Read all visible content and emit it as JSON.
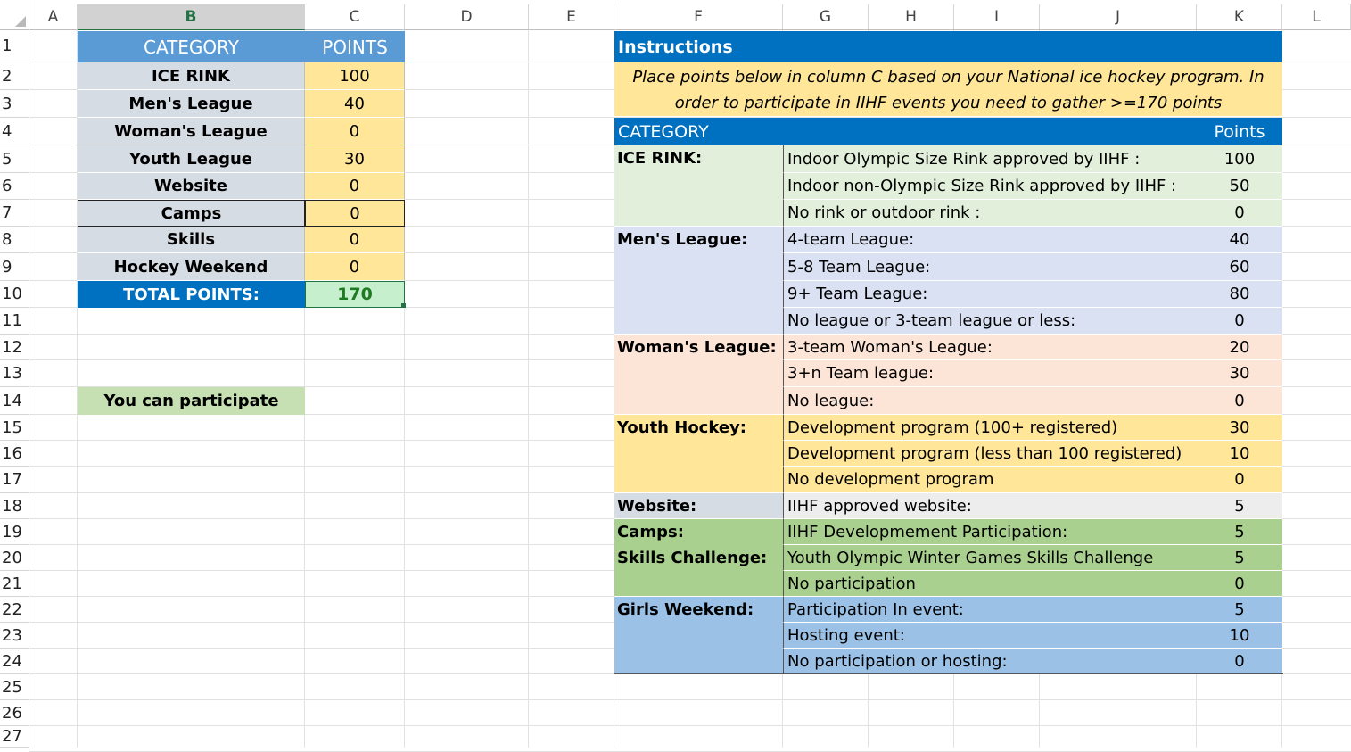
{
  "columns": [
    "A",
    "B",
    "C",
    "D",
    "E",
    "F",
    "G",
    "H",
    "I",
    "J",
    "K",
    "L"
  ],
  "selected_column": "B",
  "rows": [
    "1",
    "2",
    "3",
    "4",
    "5",
    "6",
    "7",
    "8",
    "9",
    "10",
    "11",
    "12",
    "13",
    "14",
    "15",
    "16",
    "17",
    "18",
    "19",
    "20",
    "21",
    "22",
    "23",
    "24",
    "25",
    "26",
    "27"
  ],
  "score_table": {
    "header_category": "CATEGORY",
    "header_points": "POINTS",
    "items": [
      {
        "category": "ICE RINK",
        "points": "100"
      },
      {
        "category": "Men's League",
        "points": "40"
      },
      {
        "category": "Woman's League",
        "points": "0"
      },
      {
        "category": "Youth League",
        "points": "30"
      },
      {
        "category": "Website",
        "points": "0"
      },
      {
        "category": "Camps",
        "points": "0"
      },
      {
        "category": "Skills",
        "points": "0"
      },
      {
        "category": "Hockey Weekend",
        "points": "0"
      }
    ],
    "total_label": "TOTAL POINTS:",
    "total_value": "170",
    "result": "You can participate"
  },
  "instructions": {
    "title": "Instructions",
    "line1": "Place points below in column C based on your National ice hockey program. In",
    "line2": "order to participate in IIHF events you need to gather >=170 points",
    "header_category": "CATEGORY",
    "header_points": "Points",
    "groups": [
      {
        "name": "ICE RINK:",
        "color": "#e2efda",
        "items": [
          {
            "label": "Indoor Olympic Size Rink approved by IIHF :",
            "points": "100"
          },
          {
            "label": "Indoor non-Olympic Size Rink approved by IIHF :",
            "points": "50"
          },
          {
            "label": "No rink or outdoor rink :",
            "points": "0"
          }
        ]
      },
      {
        "name": "Men's League:",
        "color": "#d9e1f2",
        "items": [
          {
            "label": "4-team League:",
            "points": "40"
          },
          {
            "label": "5-8 Team League:",
            "points": "60"
          },
          {
            "label": "9+ Team League:",
            "points": "80"
          },
          {
            "label": "No league or 3-team league or less:",
            "points": "0"
          }
        ]
      },
      {
        "name": "Woman's League:",
        "color": "#fce4d6",
        "items": [
          {
            "label": "3-team Woman's League:",
            "points": "20"
          },
          {
            "label": "3+n Team league:",
            "points": "30"
          },
          {
            "label": "No league:",
            "points": "0"
          }
        ]
      },
      {
        "name": "Youth Hockey:",
        "color": "#ffe699",
        "items": [
          {
            "label": "Development program (100+ registered)",
            "points": "30"
          },
          {
            "label": "Development program (less than 100 registered)",
            "points": "10"
          },
          {
            "label": "No development program",
            "points": "0"
          }
        ]
      },
      {
        "name": "Website:",
        "color": "#ededed",
        "name_color": "#d6dce4",
        "items": [
          {
            "label": "IIHF approved website:",
            "points": "5"
          }
        ]
      },
      {
        "name": "Camps:",
        "name2": "Skills Challenge:",
        "color": "#a9d08e",
        "items": [
          {
            "label": "IIHF Developmement Participation:",
            "points": "5"
          },
          {
            "label": "Youth Olympic Winter Games Skills Challenge",
            "points": "5"
          },
          {
            "label": "No participation",
            "points": "0"
          }
        ]
      },
      {
        "name": "Girls Weekend:",
        "color": "#9bc2e6",
        "items": [
          {
            "label": "Participation In event:",
            "points": "5"
          },
          {
            "label": "Hosting event:",
            "points": "10"
          },
          {
            "label": "No participation or hosting:",
            "points": "0"
          }
        ]
      }
    ]
  },
  "colors": {
    "header_blue": "#5b9bd5",
    "dark_blue": "#0070c0",
    "grey": "#d6dce4",
    "yellow": "#ffe699",
    "total_green_text": "#1e7b22",
    "result_green": "#c6e0b4",
    "excel_green": "#217346"
  }
}
